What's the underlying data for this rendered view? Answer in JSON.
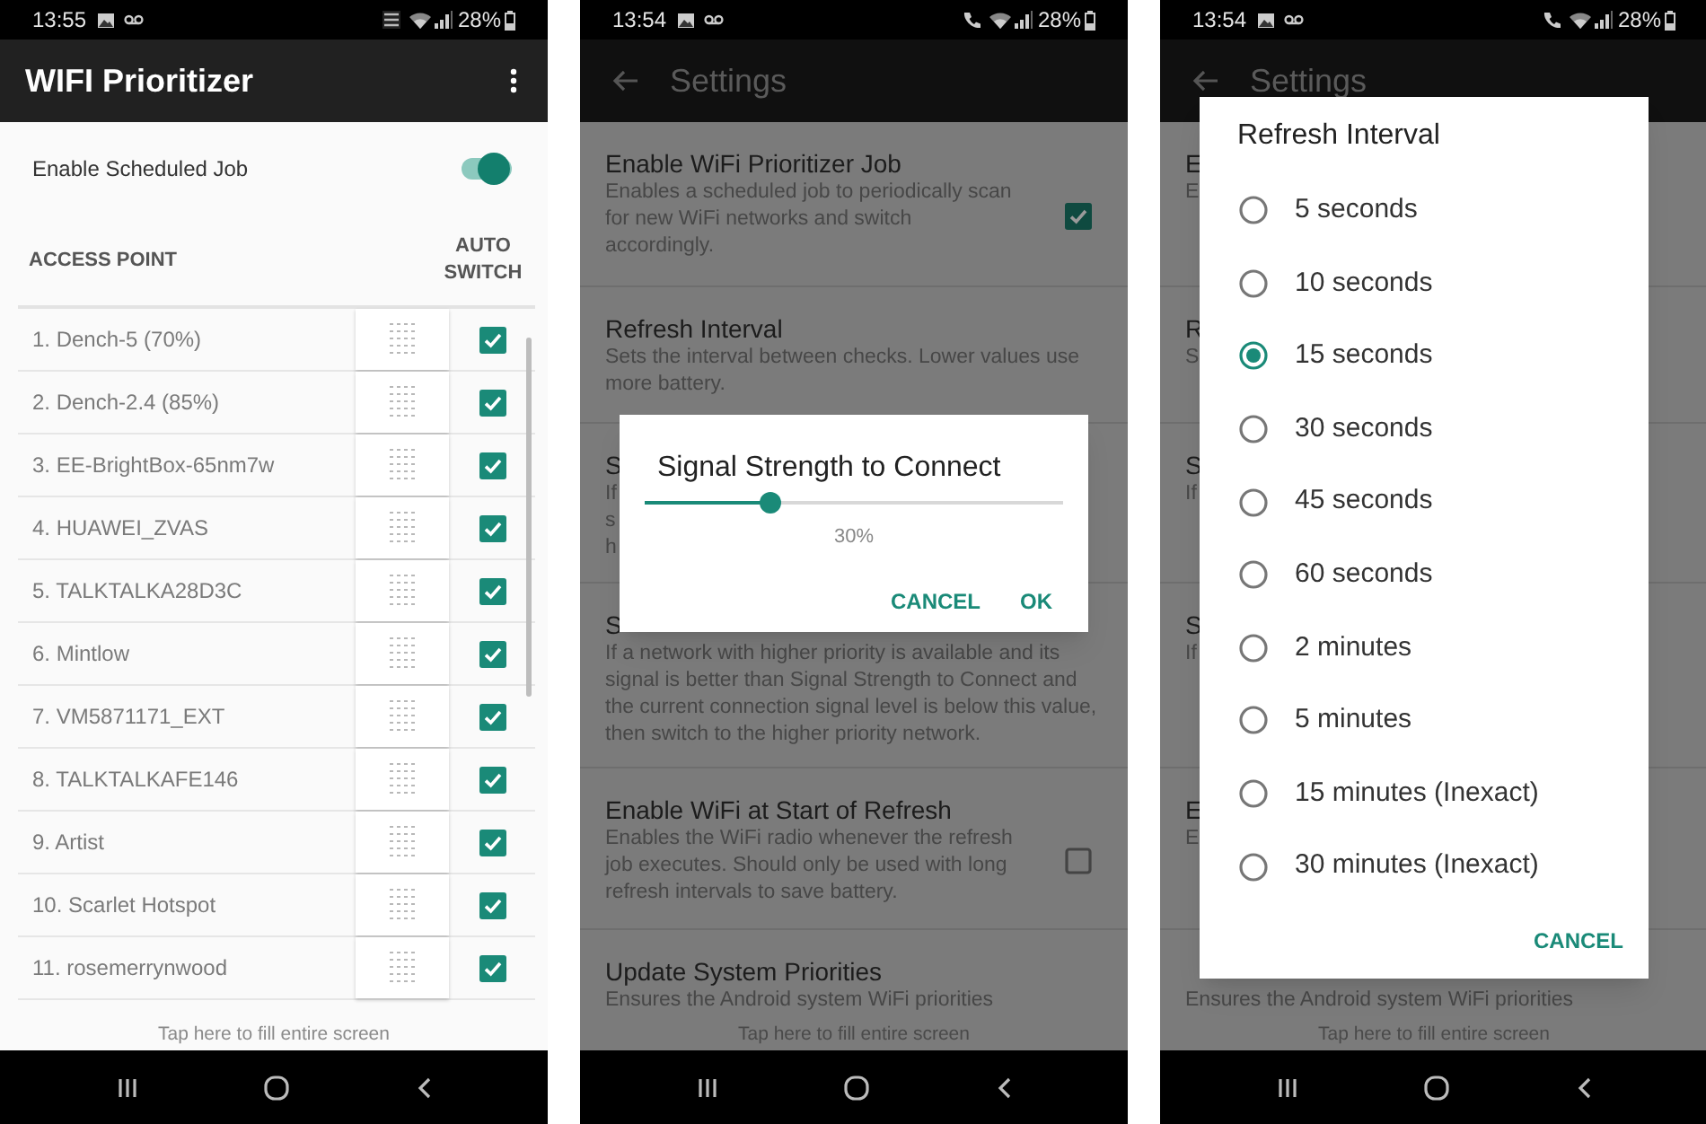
{
  "screens": [
    {
      "kind": "prioritizer",
      "status_bar": {
        "time": "13:55",
        "battery": "28%"
      },
      "app_bar": {
        "title": "WIFI Prioritizer",
        "back": false,
        "menu": true
      },
      "toggle_row": {
        "label": "Enable Scheduled Job",
        "on": true
      },
      "table": {
        "columns": [
          "ACCESS POINT",
          "AUTO SWITCH"
        ],
        "rows": [
          {
            "name": "1. Dench-5 (70%)",
            "checked": true
          },
          {
            "name": "2. Dench-2.4 (85%)",
            "checked": true
          },
          {
            "name": "3. EE-BrightBox-65nm7w",
            "checked": true
          },
          {
            "name": "4. HUAWEI_ZVAS",
            "checked": true
          },
          {
            "name": "5. TALKTALKA28D3C",
            "checked": true
          },
          {
            "name": "6. Mintlow",
            "checked": true
          },
          {
            "name": "7. VM5871171_EXT",
            "checked": true
          },
          {
            "name": "8. TALKTALKAFE146",
            "checked": true
          },
          {
            "name": "9. Artist",
            "checked": true
          },
          {
            "name": "10. Scarlet Hotspot",
            "checked": true
          },
          {
            "name": "11. rosemerrynwood",
            "checked": true
          }
        ]
      },
      "footer": "Tap here to fill entire screen"
    },
    {
      "kind": "settings",
      "status_bar": {
        "time": "13:54",
        "battery": "28%"
      },
      "app_bar": {
        "title": "Settings",
        "back": true,
        "menu": false
      },
      "items": [
        {
          "title": "Enable WiFi Prioritizer Job",
          "desc": "Enables a scheduled job to periodically scan for new WiFi networks and switch accordingly.",
          "checked": true
        },
        {
          "title": "Refresh Interval",
          "desc": "Sets the interval between checks. Lower values use more battery."
        },
        {
          "title": "S",
          "desc_lines": [
            "If",
            "s",
            "h"
          ]
        },
        {
          "title": "S",
          "desc": "If a network with higher priority is available and its signal is better than Signal Strength to Connect and the current connection signal level is below this value, then switch to the higher priority network."
        },
        {
          "title": "Enable WiFi at Start of Refresh",
          "desc": "Enables the WiFi radio whenever the refresh job executes. Should only be used with long refresh intervals to save battery.",
          "checked": false
        },
        {
          "title": "Update System Priorities",
          "desc": "Ensures the Android system WiFi priorities"
        }
      ],
      "footer": "Tap here to fill entire screen",
      "dialog": {
        "kind": "slider",
        "title": "Signal Strength to Connect",
        "level": 0.3,
        "reading": "30%",
        "buttons": [
          "CANCEL",
          "OK"
        ]
      }
    },
    {
      "kind": "settings",
      "status_bar": {
        "time": "13:54",
        "battery": "28%"
      },
      "app_bar": {
        "title": "Settings",
        "back": true,
        "menu": false
      },
      "items": [
        {
          "title": "E",
          "desc_lines": [
            "E"
          ]
        },
        {
          "title": "R",
          "desc_lines": [
            "S"
          ]
        },
        {
          "title": "S",
          "desc_lines": [
            "If"
          ]
        },
        {
          "title": "S",
          "desc_lines": [
            "If"
          ]
        },
        {
          "title": "E",
          "desc_lines": [
            "E"
          ]
        },
        {
          "desc": "Ensures the Android system WiFi priorities"
        }
      ],
      "footer": "Tap here to fill entire screen",
      "dialog": {
        "kind": "radio",
        "title": "Refresh Interval",
        "options": [
          {
            "label": "5 seconds",
            "selected": false
          },
          {
            "label": "10 seconds",
            "selected": false
          },
          {
            "label": "15 seconds",
            "selected": true
          },
          {
            "label": "30 seconds",
            "selected": false
          },
          {
            "label": "45 seconds",
            "selected": false
          },
          {
            "label": "60 seconds",
            "selected": false
          },
          {
            "label": "2 minutes",
            "selected": false
          },
          {
            "label": "5 minutes",
            "selected": false
          },
          {
            "label": "15 minutes (Inexact)",
            "selected": false
          },
          {
            "label": "30 minutes (Inexact)",
            "selected": false
          }
        ],
        "buttons": [
          "CANCEL"
        ]
      }
    }
  ]
}
